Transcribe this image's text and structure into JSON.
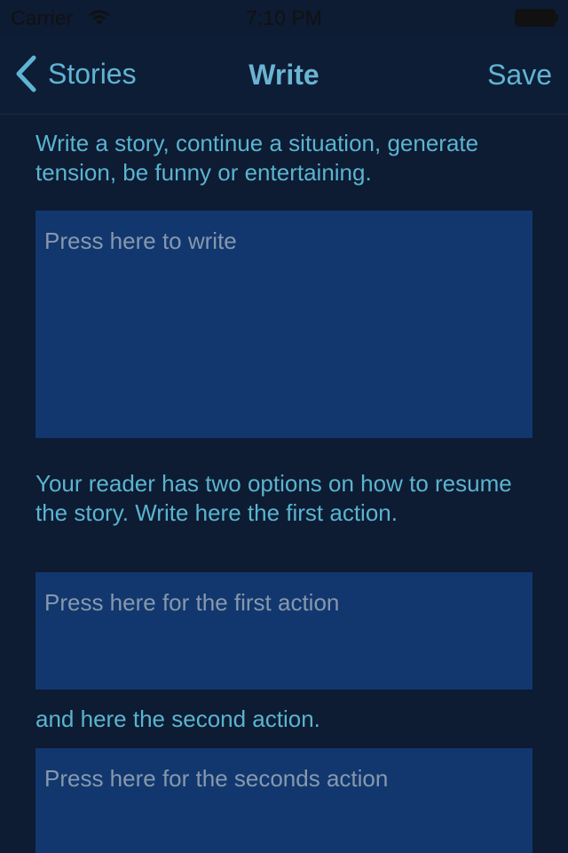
{
  "status_bar": {
    "carrier": "Carrier",
    "time": "7:10 PM",
    "icons": [
      "wifi-icon",
      "battery-icon"
    ]
  },
  "nav": {
    "back_label": "Stories",
    "title": "Write",
    "save_label": "Save",
    "back_icon": "chevron-left-icon"
  },
  "content": {
    "intro_text": "Write a story, continue a situation, generate tension, be funny or entertaining.",
    "story_placeholder": "Press here to write",
    "options_text": "Your reader has two options on how to resume the story. Write here the first action.",
    "first_action_placeholder": "Press here for the first action",
    "second_text": "and here the second action.",
    "second_action_placeholder": "Press here for the seconds action"
  },
  "colors": {
    "background": "#0d1b33",
    "accent": "#5fb4d3",
    "field_background": "#11376e",
    "placeholder": "#8798ad"
  }
}
